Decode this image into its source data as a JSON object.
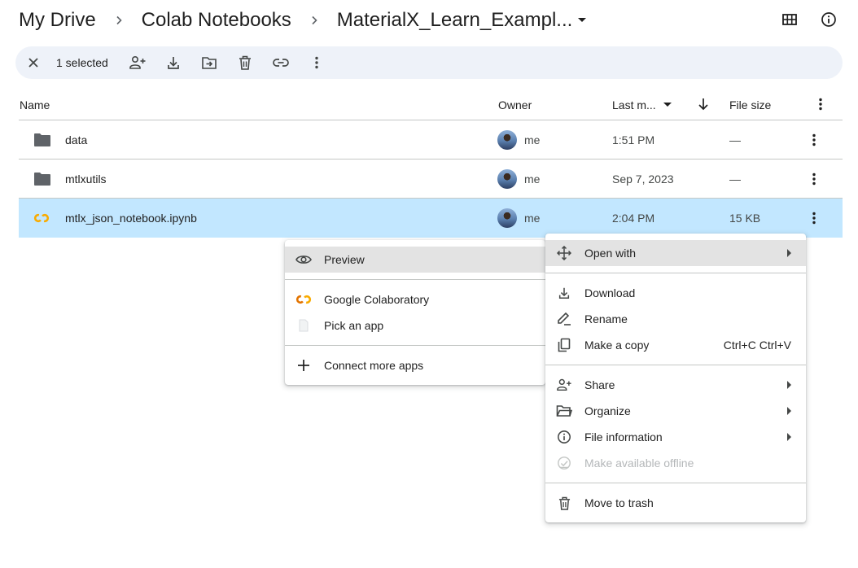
{
  "breadcrumb": {
    "root": "My Drive",
    "parent": "Colab Notebooks",
    "current": "MaterialX_Learn_Exampl..."
  },
  "selection": {
    "count_label": "1 selected"
  },
  "table": {
    "headers": {
      "name": "Name",
      "owner": "Owner",
      "last_modified": "Last m...",
      "file_size": "File size"
    },
    "rows": [
      {
        "icon": "folder-icon",
        "name": "data",
        "owner": "me",
        "modified": "1:51 PM",
        "size": "—",
        "selected": false
      },
      {
        "icon": "folder-icon",
        "name": "mtlxutils",
        "owner": "me",
        "modified": "Sep 7, 2023",
        "size": "—",
        "selected": false
      },
      {
        "icon": "colab-icon",
        "name": "mtlx_json_notebook.ipynb",
        "owner": "me",
        "modified": "2:04 PM",
        "size": "15 KB",
        "selected": true
      }
    ]
  },
  "context_menu": {
    "items": [
      {
        "label": "Open with",
        "icon": "open-with-icon"
      },
      {
        "label": "Download",
        "icon": "download-icon"
      },
      {
        "label": "Rename",
        "icon": "rename-icon"
      },
      {
        "label": "Make a copy",
        "icon": "copy-icon",
        "shortcut": "Ctrl+C Ctrl+V"
      },
      {
        "label": "Share",
        "icon": "share-icon"
      },
      {
        "label": "Organize",
        "icon": "organize-icon"
      },
      {
        "label": "File information",
        "icon": "info-icon"
      },
      {
        "label": "Make available offline",
        "icon": "offline-icon",
        "disabled": true
      },
      {
        "label": "Move to trash",
        "icon": "trash-icon"
      }
    ]
  },
  "open_with_menu": {
    "items": [
      {
        "label": "Preview",
        "icon": "eye-icon"
      },
      {
        "label": "Google Colaboratory",
        "icon": "colab-icon"
      },
      {
        "label": "Pick an app",
        "icon": "file-icon"
      },
      {
        "label": "Connect more apps",
        "icon": "plus-icon"
      }
    ]
  },
  "colors": {
    "selected_row": "#c2e7ff",
    "selection_bar": "#eef2f9",
    "hover": "#e3e3e3",
    "colab_orange": "#f9ab00",
    "colab_dark": "#e37400"
  }
}
